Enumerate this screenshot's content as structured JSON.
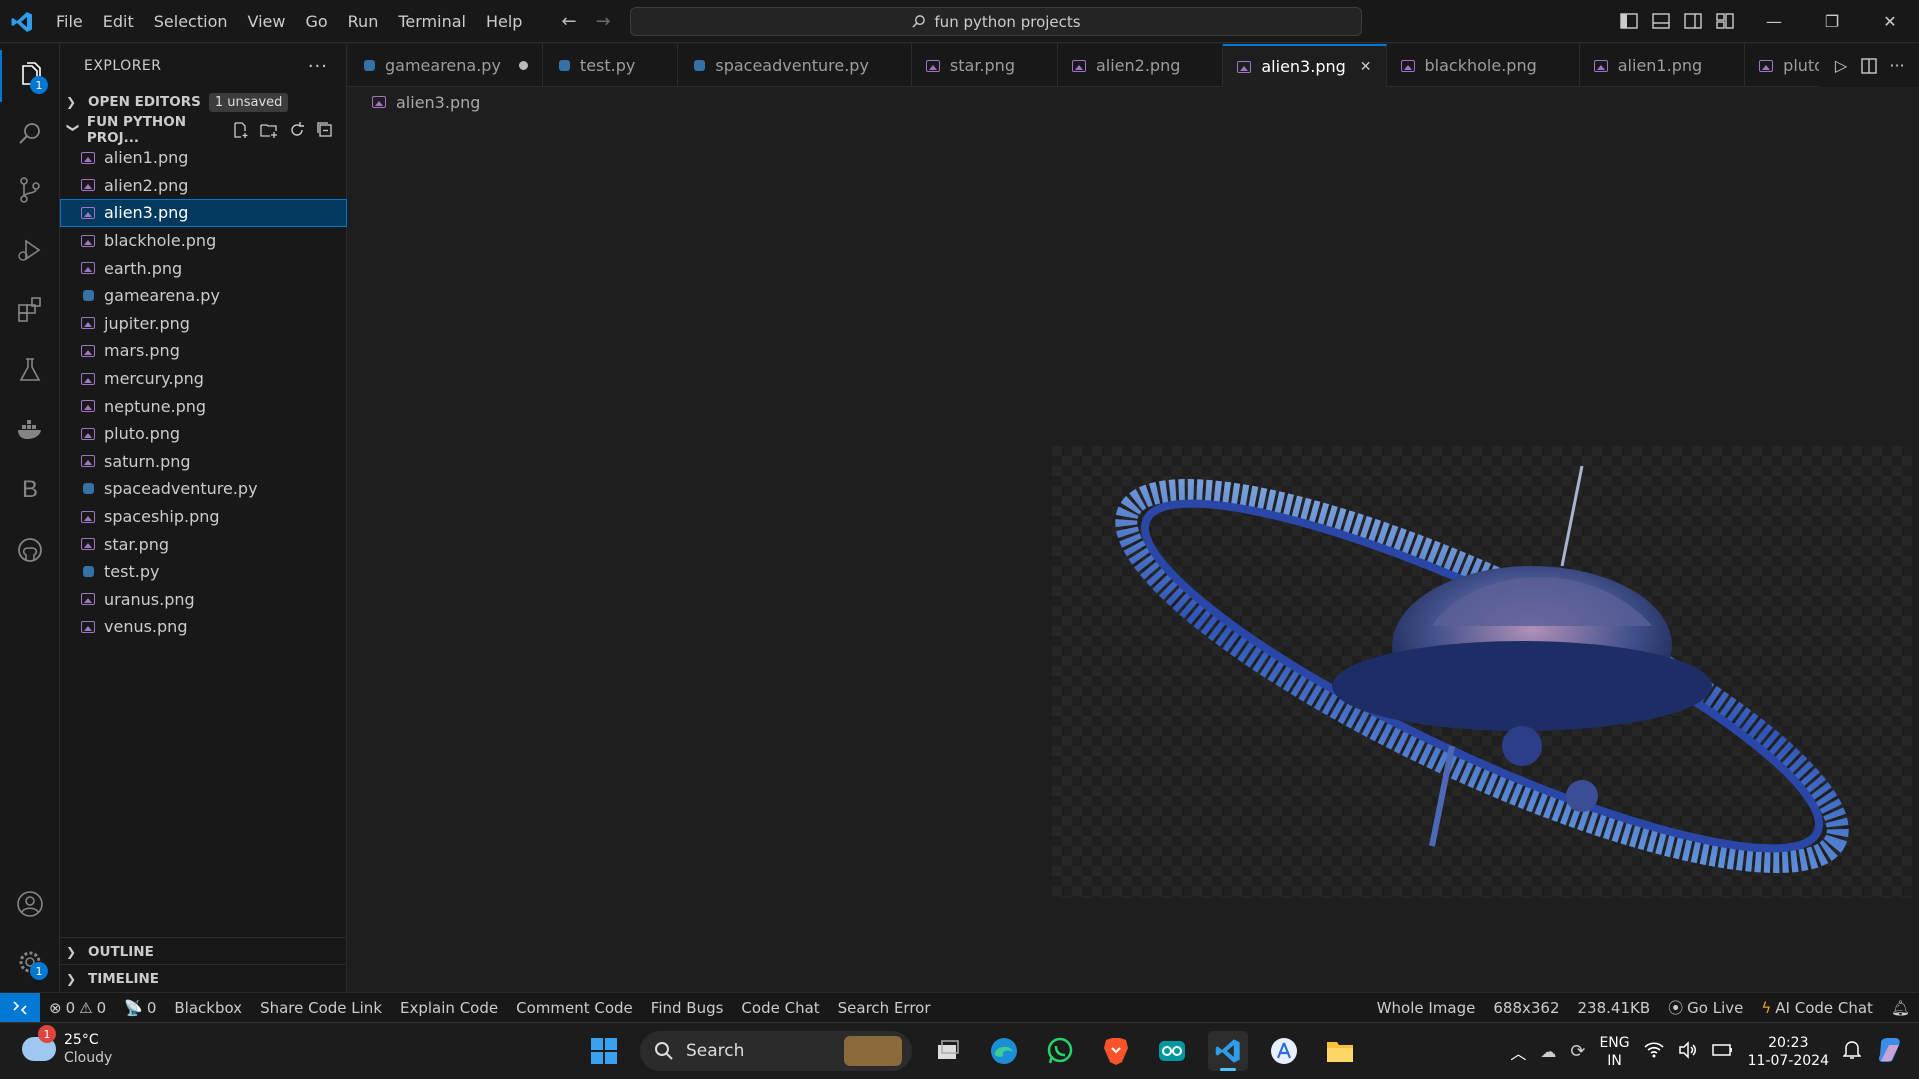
{
  "menus": [
    "File",
    "Edit",
    "Selection",
    "View",
    "Go",
    "Run",
    "Terminal",
    "Help"
  ],
  "command_center": "fun python projects",
  "activity_badges": {
    "explorer": "1",
    "settings": "1"
  },
  "sidebar": {
    "title": "EXPLORER",
    "open_editors": "OPEN EDITORS",
    "unsaved": "1 unsaved",
    "project": "FUN PYTHON PROJ...",
    "files": [
      {
        "name": "alien1.png",
        "type": "image"
      },
      {
        "name": "alien2.png",
        "type": "image"
      },
      {
        "name": "alien3.png",
        "type": "image",
        "selected": true
      },
      {
        "name": "blackhole.png",
        "type": "image"
      },
      {
        "name": "earth.png",
        "type": "image"
      },
      {
        "name": "gamearena.py",
        "type": "python"
      },
      {
        "name": "jupiter.png",
        "type": "image"
      },
      {
        "name": "mars.png",
        "type": "image"
      },
      {
        "name": "mercury.png",
        "type": "image"
      },
      {
        "name": "neptune.png",
        "type": "image"
      },
      {
        "name": "pluto.png",
        "type": "image"
      },
      {
        "name": "saturn.png",
        "type": "image"
      },
      {
        "name": "spaceadventure.py",
        "type": "python"
      },
      {
        "name": "spaceship.png",
        "type": "image"
      },
      {
        "name": "star.png",
        "type": "image"
      },
      {
        "name": "test.py",
        "type": "python"
      },
      {
        "name": "uranus.png",
        "type": "image"
      },
      {
        "name": "venus.png",
        "type": "image"
      }
    ],
    "outline": "OUTLINE",
    "timeline": "TIMELINE"
  },
  "tabs": [
    {
      "name": "gamearena.py",
      "type": "python",
      "modified": true
    },
    {
      "name": "test.py",
      "type": "python"
    },
    {
      "name": "spaceadventure.py",
      "type": "python"
    },
    {
      "name": "star.png",
      "type": "image"
    },
    {
      "name": "alien2.png",
      "type": "image"
    },
    {
      "name": "alien3.png",
      "type": "image",
      "active": true
    },
    {
      "name": "blackhole.png",
      "type": "image"
    },
    {
      "name": "alien1.png",
      "type": "image"
    },
    {
      "name": "pluto.png",
      "type": "image"
    }
  ],
  "breadcrumb": "alien3.png",
  "statusbar": {
    "errors": "0",
    "warnings": "0",
    "ports": "0",
    "left_items": [
      "Blackbox",
      "Share Code Link",
      "Explain Code",
      "Comment Code",
      "Find Bugs",
      "Code Chat",
      "Search Error"
    ],
    "whole_image": "Whole Image",
    "dimensions": "688x362",
    "size": "238.41KB",
    "go_live": "Go Live",
    "ai_chat": "AI Code Chat"
  },
  "taskbar": {
    "weather_temp": "25°C",
    "weather_desc": "Cloudy",
    "weather_badge": "1",
    "search": "Search",
    "lang_top": "ENG",
    "lang_bottom": "IN",
    "time": "20:23",
    "date": "11-07-2024"
  },
  "colors": {
    "accent": "#0078d4",
    "python": "#3572a5",
    "image": "#a074c4"
  }
}
